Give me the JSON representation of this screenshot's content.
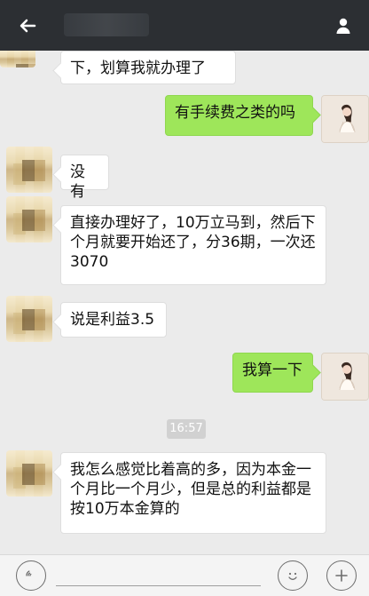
{
  "header": {
    "title": "",
    "back_icon": "back-arrow-icon",
    "profile_icon": "profile-icon"
  },
  "messages": [
    {
      "side": "left",
      "text": "下，划算我就办理了"
    },
    {
      "side": "right",
      "text": "有手续费之类的吗"
    },
    {
      "side": "left",
      "text": "没有"
    },
    {
      "side": "left",
      "text": "直接办理好了，10万立马到，然后下个月就要开始还了，分36期，一次还3070"
    },
    {
      "side": "left",
      "text": "说是利益3.5"
    },
    {
      "side": "right",
      "text": "我算一下"
    },
    {
      "side": "left",
      "text": "我怎么感觉比着高的多，因为本金一个月比一个月少，但是总的利益都是按10万本金算的"
    }
  ],
  "timestamp": "16:57",
  "footer": {
    "voice_icon": "voice-icon",
    "emoji_icon": "emoji-icon",
    "plus_icon": "plus-icon"
  },
  "colors": {
    "topbar": "#2c2f33",
    "background": "#ebebeb",
    "bubble_left": "#ffffff",
    "bubble_right": "#9ee65a",
    "timestamp_bg": "#d1d1d1"
  }
}
